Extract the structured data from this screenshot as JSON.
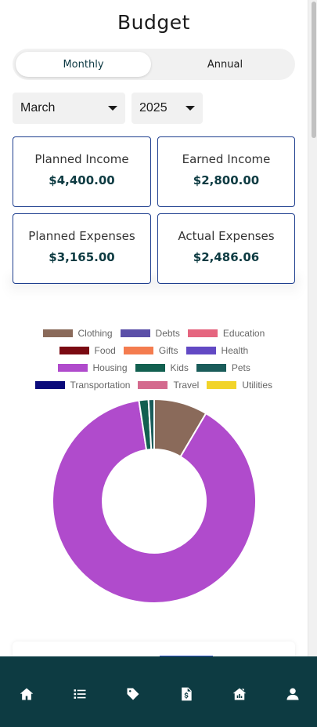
{
  "header": {
    "title": "Budget"
  },
  "period_toggle": {
    "options": [
      "Monthly",
      "Annual"
    ],
    "selected": "Monthly"
  },
  "filters": {
    "month": "March",
    "year": "2025"
  },
  "summary_cards": [
    {
      "label": "Planned Income",
      "value": "$4,400.00"
    },
    {
      "label": "Earned Income",
      "value": "$2,800.00"
    },
    {
      "label": "Planned Expenses",
      "value": "$3,165.00"
    },
    {
      "label": "Actual Expenses",
      "value": "$2,486.06"
    }
  ],
  "chart_data": {
    "type": "pie",
    "donut": true,
    "legend_position": "top",
    "categories": [
      "Clothing",
      "Debts",
      "Education",
      "Food",
      "Gifts",
      "Health",
      "Housing",
      "Kids",
      "Pets",
      "Transportation",
      "Travel",
      "Utilities"
    ],
    "colors": [
      "#8a6a5a",
      "#5b4fa8",
      "#e5657f",
      "#7a0a12",
      "#f47c4f",
      "#6249c4",
      "#b04bcc",
      "#126050",
      "#1a5c5a",
      "#0a0a7a",
      "#d46a8e",
      "#f2d42a"
    ],
    "values": [
      8.5,
      0,
      0,
      0,
      0,
      0,
      89.1,
      1.5,
      0.9,
      0,
      0,
      0
    ]
  },
  "navbar": {
    "items": [
      {
        "name": "home-icon"
      },
      {
        "name": "list-icon"
      },
      {
        "name": "tag-icon"
      },
      {
        "name": "invoice-icon"
      },
      {
        "name": "house-chart-icon"
      },
      {
        "name": "user-icon"
      }
    ],
    "color": "#0d3b42"
  }
}
